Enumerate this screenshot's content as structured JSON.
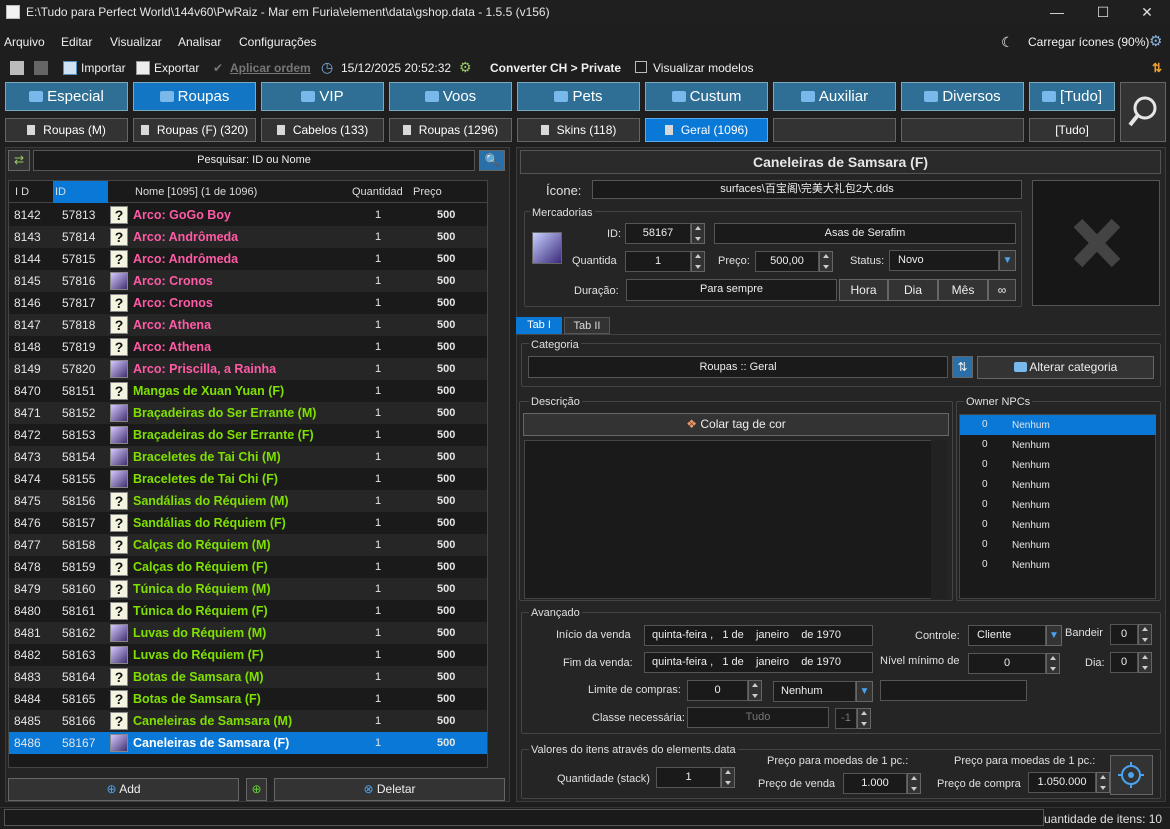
{
  "window": {
    "title": "E:\\Tudo para Perfect World\\144v60\\PwRaiz - Mar em Furia\\element\\data\\gshop.data - 1.5.5 (v156)",
    "minimize": "—",
    "maximize": "☐",
    "close": "✕"
  },
  "menu": [
    "Arquivo",
    "Editar",
    "Visualizar",
    "Analisar",
    "Configurações"
  ],
  "menu_right": {
    "load_icons": "Carregar ícones (90%)"
  },
  "toolbar": {
    "import": "Importar",
    "export": "Exportar",
    "apply_order": "Aplicar ordem",
    "datetime": "15/12/2025 20:52:32",
    "convert": "Converter CH > Private",
    "view_models": "Visualizar modelos"
  },
  "categories": [
    "Especial",
    "Roupas",
    "VIP",
    "Voos",
    "Pets",
    "Custum",
    "Auxiliar",
    "Diversos",
    "[Tudo]"
  ],
  "subcategories": [
    "Roupas (M)",
    "Roupas (F) (320)",
    "Cabelos (133)",
    "Roupas (1296)",
    "Skins (118)",
    "Geral (1096)",
    "",
    "",
    "[Tudo]"
  ],
  "search": {
    "placeholder": "Pesquisar: ID ou Nome"
  },
  "list": {
    "headers": {
      "idx": "I D",
      "id": "ID",
      "name": "Nome [1095] (1 de 1096)",
      "qty": "Quantidad",
      "price": "Preço"
    },
    "rows": [
      {
        "idx": "8142",
        "id": "57813",
        "name": "Arco: GoGo Boy",
        "qty": "1",
        "price": "500",
        "color": "#ff5aa5",
        "icon": "q"
      },
      {
        "idx": "8143",
        "id": "57814",
        "name": "Arco: Andrômeda",
        "qty": "1",
        "price": "500",
        "color": "#ff5aa5",
        "icon": "q"
      },
      {
        "idx": "8144",
        "id": "57815",
        "name": "Arco: Andrômeda",
        "qty": "1",
        "price": "500",
        "color": "#ff5aa5",
        "icon": "q"
      },
      {
        "idx": "8145",
        "id": "57816",
        "name": "Arco: Cronos",
        "qty": "1",
        "price": "500",
        "color": "#ff5aa5",
        "icon": "img"
      },
      {
        "idx": "8146",
        "id": "57817",
        "name": "Arco: Cronos",
        "qty": "1",
        "price": "500",
        "color": "#ff5aa5",
        "icon": "q"
      },
      {
        "idx": "8147",
        "id": "57818",
        "name": "Arco: Athena",
        "qty": "1",
        "price": "500",
        "color": "#ff5aa5",
        "icon": "q"
      },
      {
        "idx": "8148",
        "id": "57819",
        "name": "Arco: Athena",
        "qty": "1",
        "price": "500",
        "color": "#ff5aa5",
        "icon": "q"
      },
      {
        "idx": "8149",
        "id": "57820",
        "name": "Arco: Priscilla, a Rainha",
        "qty": "1",
        "price": "500",
        "color": "#ff5aa5",
        "icon": "img"
      },
      {
        "idx": "8470",
        "id": "58151",
        "name": "Mangas de Xuan Yuan (F)",
        "qty": "1",
        "price": "500",
        "color": "#7fe000",
        "icon": "q"
      },
      {
        "idx": "8471",
        "id": "58152",
        "name": "Braçadeiras do Ser Errante (M)",
        "qty": "1",
        "price": "500",
        "color": "#7fe000",
        "icon": "img"
      },
      {
        "idx": "8472",
        "id": "58153",
        "name": "Braçadeiras do Ser Errante (F)",
        "qty": "1",
        "price": "500",
        "color": "#7fe000",
        "icon": "img"
      },
      {
        "idx": "8473",
        "id": "58154",
        "name": "Braceletes de Tai Chi (M)",
        "qty": "1",
        "price": "500",
        "color": "#7fe000",
        "icon": "img"
      },
      {
        "idx": "8474",
        "id": "58155",
        "name": "Braceletes de Tai Chi (F)",
        "qty": "1",
        "price": "500",
        "color": "#7fe000",
        "icon": "img"
      },
      {
        "idx": "8475",
        "id": "58156",
        "name": "Sandálias do Réquiem (M)",
        "qty": "1",
        "price": "500",
        "color": "#7fe000",
        "icon": "q"
      },
      {
        "idx": "8476",
        "id": "58157",
        "name": "Sandálias do Réquiem (F)",
        "qty": "1",
        "price": "500",
        "color": "#7fe000",
        "icon": "q"
      },
      {
        "idx": "8477",
        "id": "58158",
        "name": "Calças do Réquiem (M)",
        "qty": "1",
        "price": "500",
        "color": "#7fe000",
        "icon": "q"
      },
      {
        "idx": "8478",
        "id": "58159",
        "name": "Calças do Réquiem (F)",
        "qty": "1",
        "price": "500",
        "color": "#7fe000",
        "icon": "q"
      },
      {
        "idx": "8479",
        "id": "58160",
        "name": "Túnica do Réquiem (M)",
        "qty": "1",
        "price": "500",
        "color": "#7fe000",
        "icon": "q"
      },
      {
        "idx": "8480",
        "id": "58161",
        "name": "Túnica do Réquiem (F)",
        "qty": "1",
        "price": "500",
        "color": "#7fe000",
        "icon": "q"
      },
      {
        "idx": "8481",
        "id": "58162",
        "name": "Luvas do Réquiem (M)",
        "qty": "1",
        "price": "500",
        "color": "#7fe000",
        "icon": "img"
      },
      {
        "idx": "8482",
        "id": "58163",
        "name": "Luvas do Réquiem (F)",
        "qty": "1",
        "price": "500",
        "color": "#7fe000",
        "icon": "img"
      },
      {
        "idx": "8483",
        "id": "58164",
        "name": "Botas de Samsara (M)",
        "qty": "1",
        "price": "500",
        "color": "#7fe000",
        "icon": "q"
      },
      {
        "idx": "8484",
        "id": "58165",
        "name": "Botas de Samsara (F)",
        "qty": "1",
        "price": "500",
        "color": "#7fe000",
        "icon": "q"
      },
      {
        "idx": "8485",
        "id": "58166",
        "name": "Caneleiras de Samsara (M)",
        "qty": "1",
        "price": "500",
        "color": "#7fe000",
        "icon": "q"
      },
      {
        "idx": "8486",
        "id": "58167",
        "name": "Caneleiras de Samsara (F)",
        "qty": "1",
        "price": "500",
        "color": "#ffffff",
        "icon": "img"
      }
    ]
  },
  "bottom_buttons": {
    "add": "Add",
    "delete": "Deletar"
  },
  "detail": {
    "title": "Caneleiras de Samsara (F)",
    "icon_label": "Ícone:",
    "icon_path": "surfaces\\百宝阁\\完美大礼包2大.dds",
    "merch_label": "Mercadorias",
    "id_label": "ID:",
    "id_value": "58167",
    "item_name": "Asas de Serafim",
    "qty_label": "Quantida",
    "qty_value": "1",
    "price_label": "Preço:",
    "price_value": "500,00",
    "status_label": "Status:",
    "status_value": "Novo",
    "duration_label": "Duração:",
    "duration_value": "Para sempre",
    "dur_buttons": [
      "Hora",
      "Dia",
      "Mês",
      "∞"
    ]
  },
  "tabs": [
    "Tab I",
    "Tab II"
  ],
  "category_box": {
    "label": "Categoria",
    "value": "Roupas :: Geral",
    "change": "Alterar categoria"
  },
  "description": {
    "label": "Descrição",
    "paste_color": "Colar tag de cor"
  },
  "owner_npcs": {
    "label": "Owner NPCs",
    "rows": [
      [
        "0",
        "Nenhum"
      ],
      [
        "0",
        "Nenhum"
      ],
      [
        "0",
        "Nenhum"
      ],
      [
        "0",
        "Nenhum"
      ],
      [
        "0",
        "Nenhum"
      ],
      [
        "0",
        "Nenhum"
      ],
      [
        "0",
        "Nenhum"
      ],
      [
        "0",
        "Nenhum"
      ]
    ]
  },
  "advanced": {
    "label": "Avançado",
    "start_label": "Início da venda",
    "start_value": "quinta-feira ,   1 de    janeiro    de 1970",
    "end_label": "Fim da venda:",
    "end_value": "quinta-feira ,   1 de    janeiro    de 1970",
    "control_label": "Controle:",
    "control_value": "Cliente",
    "flag_label": "Bandeir",
    "flag_value": "0",
    "minlevel_label": "Nível mínimo de",
    "minlevel_value": "0",
    "day_label": "Dia:",
    "day_value": "0",
    "limit_label": "Limite de compras:",
    "limit_value": "0",
    "limit_type": "Nenhum",
    "class_label": "Classe necessária:",
    "class_value": "Tudo",
    "class_num": "-1"
  },
  "values": {
    "label": "Valores do itens através do elements.data",
    "stack_label": "Quantidade (stack)",
    "stack_value": "1",
    "sell_header": "Preço para moedas de 1 pc.:",
    "sell_label": "Preço de venda",
    "sell_value": "1.000",
    "buy_header": "Preço para moedas de 1 pc.:",
    "buy_label": "Preço de compra",
    "buy_value": "1.050.000"
  },
  "statusbar": {
    "text": "uantidade de itens: 10"
  }
}
